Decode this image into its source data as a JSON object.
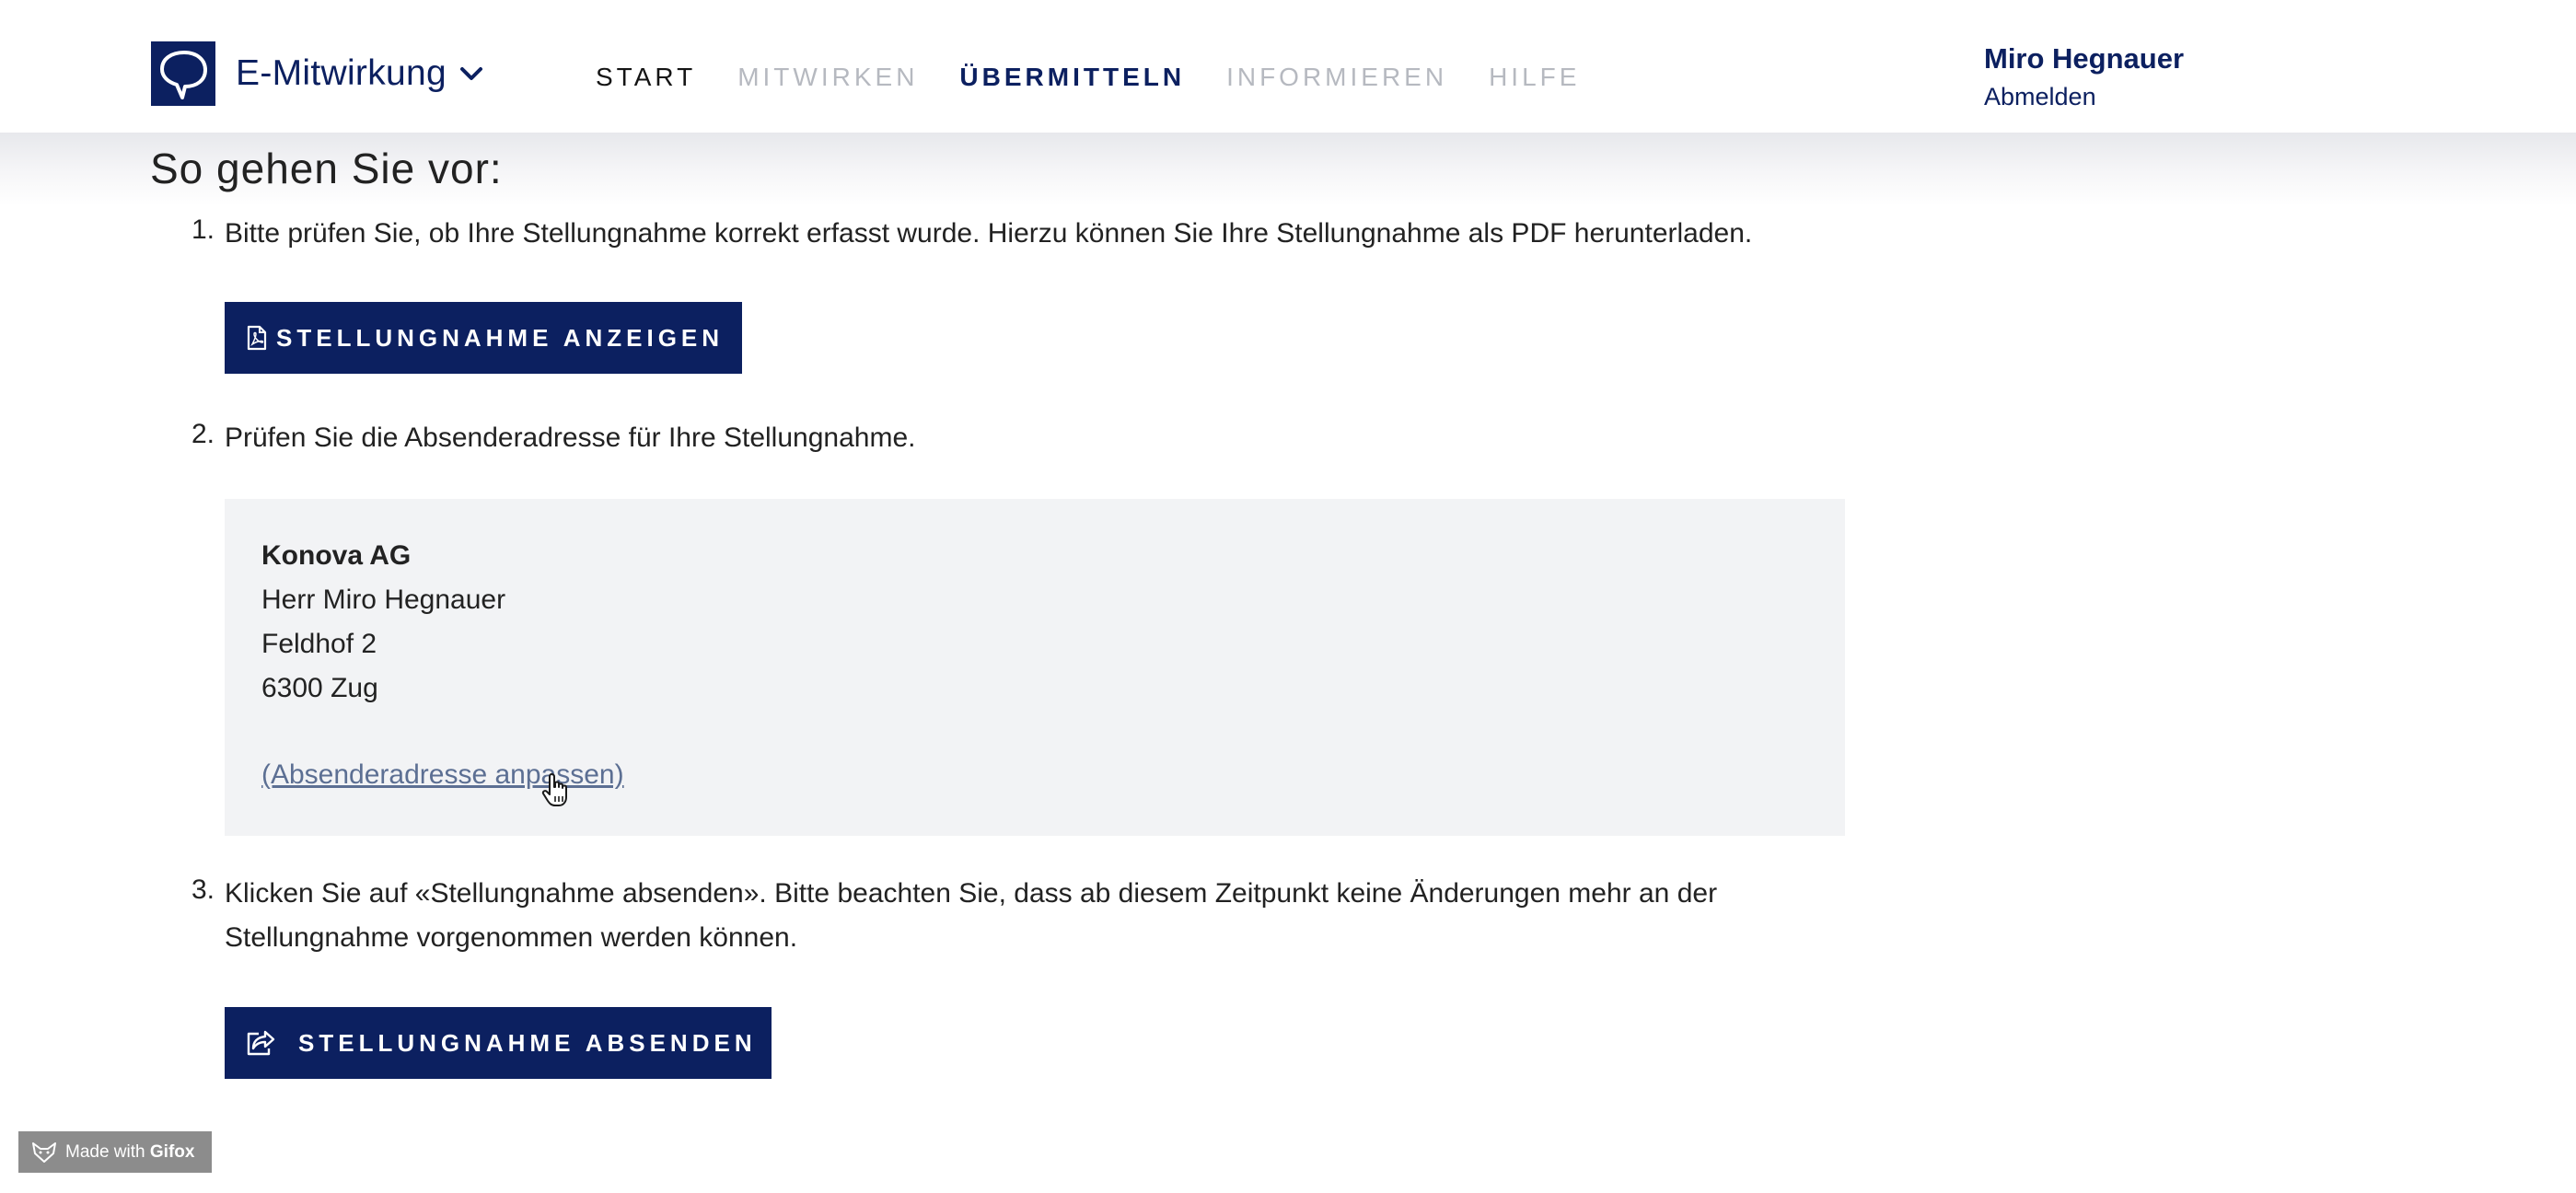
{
  "header": {
    "app_name": "E-Mitwirkung",
    "nav": [
      {
        "label": "START",
        "state": "default"
      },
      {
        "label": "MITWIRKEN",
        "state": "muted"
      },
      {
        "label": "ÜBERMITTELN",
        "state": "active"
      },
      {
        "label": "INFORMIEREN",
        "state": "muted"
      },
      {
        "label": "HILFE",
        "state": "muted"
      }
    ],
    "user_name": "Miro Hegnauer",
    "logout_label": "Abmelden"
  },
  "main": {
    "heading": "So gehen Sie vor:",
    "steps": [
      {
        "number": "1.",
        "text": "Bitte prüfen Sie, ob Ihre Stellungnahme korrekt erfasst wurde. Hierzu können Sie Ihre Stellungnahme als PDF herunterladen."
      },
      {
        "number": "2.",
        "text": "Prüfen Sie die Absenderadresse für Ihre Stellungnahme."
      },
      {
        "number": "3.",
        "text_line1": "Klicken Sie auf «Stellungnahme absenden». Bitte beachten Sie, dass ab diesem Zeitpunkt keine Änderungen mehr an der",
        "text_line2": "Stellungnahme vorgenommen werden können."
      }
    ],
    "view_button_label": "STELLUNGNAHME ANZEIGEN",
    "submit_button_label": "STELLUNGNAHME ABSENDEN",
    "address": {
      "company": "Konova AG",
      "name": "Herr Miro Hegnauer",
      "street": "Feldhof 2",
      "city": "6300 Zug",
      "edit_link": "(Absenderadresse anpassen)"
    }
  },
  "watermark": {
    "prefix": "Made with",
    "brand": "Gifox"
  },
  "colors": {
    "primary": "#0c2060",
    "muted_nav": "#b6b9c0",
    "address_bg": "#f2f3f5",
    "link": "#5c6f93"
  },
  "icons": [
    "speech-bubble-logo-icon",
    "chevron-down-icon",
    "pdf-file-icon",
    "share-icon",
    "hand-cursor-icon",
    "fox-icon"
  ]
}
